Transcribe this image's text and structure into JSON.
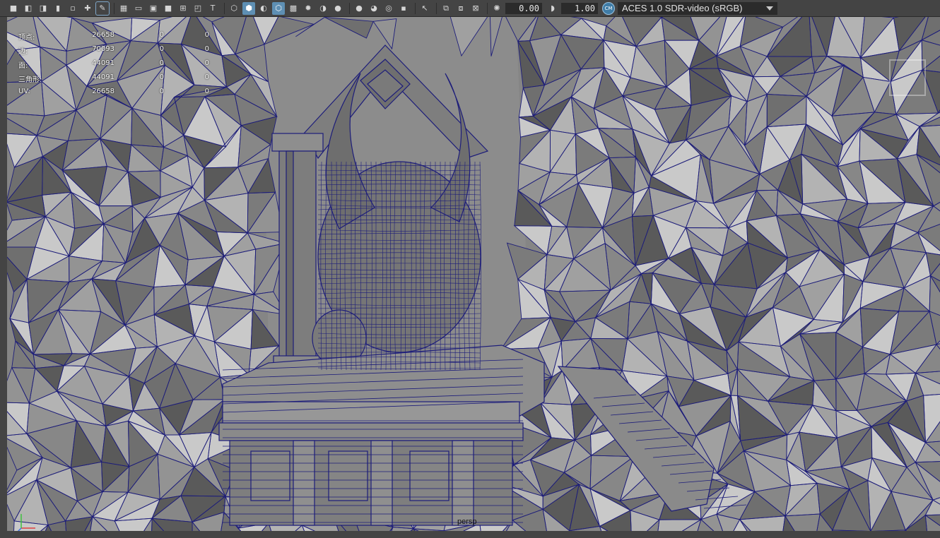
{
  "toolbar": {
    "icons": [
      "camera-icon",
      "camera-lock-icon",
      "camera-attr-icon",
      "bookmark-icon",
      "image-plane-icon",
      "move-2d-icon",
      "grease-pencil-icon",
      "grid-icon",
      "film-gate-icon",
      "resolution-gate-icon",
      "gate-mask-icon",
      "field-chart-icon",
      "safe-action-icon",
      "safe-title-icon",
      "wireframe-icon",
      "smooth-shade-icon",
      "default-material-icon",
      "wireframe-on-shaded-icon",
      "textured-icon",
      "lights-icon",
      "shadows-icon",
      "ambient-occlusion-icon",
      "isolate-select-icon",
      "xray-icon",
      "xray-joints-icon",
      "xray-components-icon",
      "select-camera-icon",
      "resolution-mask-icon",
      "frame-all-icon",
      "frame-selection-icon",
      "exposure-icon",
      "gamma-icon"
    ],
    "exposure_value": "0.00",
    "gamma_value": "1.00",
    "color_management_badge": "CM",
    "color_space": "ACES 1.0 SDR-video (sRGB)"
  },
  "hud": {
    "rows": [
      {
        "label": "顶点:",
        "c1": "26658",
        "c2": "0",
        "c3": "0"
      },
      {
        "label": "边:",
        "c1": "70093",
        "c2": "0",
        "c3": "0"
      },
      {
        "label": "面:",
        "c1": "44091",
        "c2": "0",
        "c3": "0"
      },
      {
        "label": "三角形:",
        "c1": "44091",
        "c2": "0",
        "c3": "0"
      },
      {
        "label": "UV:",
        "c1": "26658",
        "c2": "0",
        "c3": "0"
      }
    ]
  },
  "viewport": {
    "camera_label": "persp",
    "wire_color": "#1d1d7a",
    "rock_color": "#8e8e8e",
    "background_color": "#858585"
  }
}
